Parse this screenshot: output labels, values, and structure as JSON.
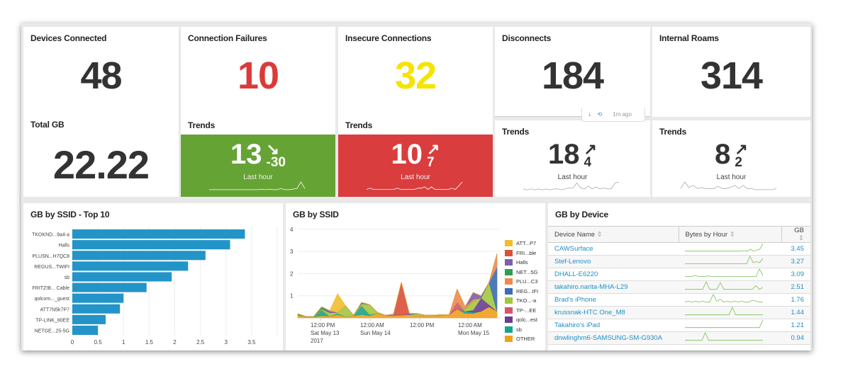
{
  "kpis": [
    {
      "title": "Devices Connected",
      "value": "48",
      "color": "#333333"
    },
    {
      "title": "Connection Failures",
      "value": "10",
      "color": "#dc3a3a"
    },
    {
      "title": "Insecure Connections",
      "value": "32",
      "color": "#f5e400"
    },
    {
      "title": "Disconnects",
      "value": "184",
      "color": "#333333"
    },
    {
      "title": "Internal Roams",
      "value": "314",
      "color": "#333333"
    }
  ],
  "total_gb": {
    "title": "Total GB",
    "value": "22.22"
  },
  "toolbar": {
    "download_icon": "download-icon",
    "refresh_icon": "refresh-icon",
    "updated": "1m ago"
  },
  "trends": [
    {
      "title": "Trends",
      "value": "13",
      "delta": "-30",
      "direction": "down",
      "label": "Last hour",
      "bg": "#66a335",
      "spark": [
        2,
        2,
        2,
        2,
        2,
        2,
        2,
        2,
        2,
        2,
        2,
        2,
        2,
        2.3,
        2,
        2.5,
        2,
        2,
        3,
        2,
        2,
        2.5,
        3,
        9,
        3
      ]
    },
    {
      "title": "Trends",
      "value": "10",
      "delta": "7",
      "direction": "up",
      "label": "Last hour",
      "bg": "#d93d3d",
      "spark": [
        2,
        3,
        2,
        2,
        2,
        2,
        2,
        2,
        2,
        3,
        2,
        2,
        2,
        2,
        2,
        3,
        3,
        4,
        2,
        4,
        2,
        2,
        2,
        2,
        2,
        3,
        2,
        5,
        8
      ]
    },
    {
      "title": "Trends",
      "value": "18",
      "delta": "4",
      "direction": "up",
      "label": "Last hour",
      "bg": "#ffffff",
      "spark": [
        3,
        2,
        3,
        2,
        3,
        2,
        3,
        2,
        3,
        3,
        2,
        3,
        4,
        4,
        9,
        4,
        3,
        6,
        3,
        5,
        3,
        4,
        3,
        3,
        9,
        10
      ]
    },
    {
      "title": "Trends",
      "value": "8",
      "delta": "2",
      "direction": "up",
      "label": "Last hour",
      "bg": "#ffffff",
      "spark": [
        3,
        9,
        4,
        6,
        3,
        4,
        3,
        3,
        3,
        5,
        3,
        3,
        4,
        6,
        3,
        6,
        3,
        3,
        2,
        2,
        2,
        2,
        2,
        3
      ]
    }
  ],
  "bar_chart": {
    "title": "GB by SSID - Top 10",
    "chart_data": {
      "type": "bar",
      "orientation": "horizontal",
      "categories": [
        "TKOKND...9a4-a",
        "Halls",
        "PLUSN...H7QC8",
        "REGUS...TWIFI",
        "sb",
        "FRITZ!B... Cable",
        "qolcom..._guest",
        "ATT7N5k7P7",
        "TP-LINK_80EE",
        "NETGE...25-5G"
      ],
      "values": [
        3.37,
        3.08,
        2.6,
        2.26,
        1.94,
        1.45,
        1.0,
        0.93,
        0.65,
        0.5
      ],
      "xlim": [
        0,
        4
      ],
      "xticks": [
        "0",
        "0.5",
        "1",
        "1.5",
        "2",
        "2.5",
        "3",
        "3.5"
      ],
      "grid": true,
      "color": "#2394c7"
    }
  },
  "area_chart": {
    "title": "GB by SSID",
    "chart_data": {
      "type": "area",
      "stacked": true,
      "ylim": [
        0,
        4
      ],
      "yticks": [
        "1",
        "2",
        "3",
        "4"
      ],
      "xticks": [
        {
          "l1": "12:00 PM",
          "l2": "Sat May 13",
          "l3": "2017"
        },
        {
          "l1": "12:00 AM",
          "l2": "Sun May 14",
          "l3": ""
        },
        {
          "l1": "12:00 PM",
          "l2": "",
          "l3": ""
        },
        {
          "l1": "12:00 AM",
          "l2": "Mon May 15",
          "l3": ""
        }
      ],
      "legend": "right",
      "series": [
        {
          "name": "OTHER",
          "color": "#f0a01c",
          "values": [
            0.12,
            0.05,
            0.05,
            0.1,
            0.08,
            0.15,
            0.05,
            0.1,
            0.15,
            0.1,
            0.2,
            0.1,
            0.1,
            0.12,
            0.15,
            0.1,
            0.1,
            0.1,
            0.1,
            0.15,
            0.4,
            0.2,
            0.2,
            0.3,
            0.5,
            0.3
          ]
        },
        {
          "name": "sb",
          "color": "#17a589",
          "values": [
            0.05,
            0,
            0,
            0.25,
            0,
            0.05,
            0,
            0,
            0.4,
            0.05,
            0,
            0,
            0,
            0,
            0,
            0,
            0,
            0,
            0,
            0,
            0,
            0.1,
            0.05,
            0,
            0,
            0
          ]
        },
        {
          "name": "qolc...est",
          "color": "#6c3d8f",
          "values": [
            0,
            0,
            0,
            0,
            0,
            0,
            0,
            0,
            0,
            0,
            0,
            0,
            0,
            0,
            0,
            0,
            0,
            0,
            0,
            0,
            0,
            0,
            0.1,
            0.6,
            0.1,
            0
          ]
        },
        {
          "name": "TP-...EE",
          "color": "#d9536b",
          "values": [
            0,
            0,
            0,
            0,
            0,
            0,
            0,
            0,
            0,
            0,
            0,
            0,
            0,
            0,
            0,
            0,
            0,
            0,
            0,
            0,
            0.3,
            0,
            0,
            0,
            0,
            0
          ]
        },
        {
          "name": "TKO...-a",
          "color": "#a2c83e",
          "values": [
            0.02,
            0.02,
            0.02,
            0.05,
            0.15,
            0.05,
            0.5,
            0.02,
            0.1,
            0.45,
            0.05,
            0.02,
            0.02,
            0,
            0,
            0.1,
            0.02,
            0.02,
            0.05,
            0,
            0,
            0.1,
            0.4,
            0,
            1.0,
            0
          ]
        },
        {
          "name": "REG...IFI",
          "color": "#3a6db3",
          "values": [
            0,
            0,
            0,
            0,
            0,
            0,
            0,
            0,
            0,
            0,
            0,
            0,
            0,
            0,
            0,
            0,
            0,
            0,
            0,
            0,
            0,
            0,
            0,
            0,
            0,
            2.0
          ]
        },
        {
          "name": "PLU...C3",
          "color": "#ef8a4f",
          "values": [
            0,
            0,
            0,
            0,
            0,
            0,
            0,
            0,
            0,
            0,
            0,
            0,
            0,
            0,
            0,
            0,
            0,
            0,
            0,
            0,
            0.6,
            0.1,
            0.1,
            0,
            0,
            0.6
          ]
        },
        {
          "name": "NET...5G",
          "color": "#2e9e56",
          "values": [
            0,
            0,
            0,
            0.1,
            0,
            0,
            0,
            0,
            0,
            0,
            0,
            0,
            0,
            0,
            0,
            0,
            0,
            0,
            0,
            0,
            0,
            0,
            0,
            0,
            0,
            0
          ]
        },
        {
          "name": "Halls",
          "color": "#7b60ad",
          "values": [
            0,
            0,
            0,
            0,
            0.1,
            0,
            0,
            0,
            0.05,
            0,
            0,
            0,
            0.05,
            0,
            0.05,
            0,
            0,
            0,
            0,
            0,
            0,
            0,
            0.3,
            0.1,
            0,
            0
          ]
        },
        {
          "name": "FRI...ble",
          "color": "#d9513a",
          "values": [
            0,
            0,
            0,
            0,
            0,
            0,
            0,
            0,
            0,
            0,
            0,
            0,
            0,
            1.5,
            0,
            0,
            0,
            0,
            0,
            0,
            0,
            0,
            0,
            0,
            0,
            0
          ]
        },
        {
          "name": "ATT...P7",
          "color": "#f2bc2f",
          "values": [
            0,
            0,
            0,
            0,
            0,
            0.85,
            0,
            0,
            0,
            0,
            0,
            0,
            0,
            0,
            0,
            0,
            0,
            0,
            0,
            0,
            0,
            0,
            0,
            0,
            0,
            0
          ]
        }
      ]
    }
  },
  "device_table": {
    "title": "GB by Device",
    "columns": [
      "Device Name",
      "Bytes by Hour",
      "GB"
    ],
    "rows": [
      {
        "name": "CAWSurface",
        "gb": "3.45",
        "spark": [
          1,
          1,
          1,
          1,
          1,
          1,
          1,
          1,
          1,
          1,
          1,
          1,
          1,
          1,
          1,
          1,
          1,
          1,
          1,
          1.5,
          1,
          3,
          1,
          2,
          3,
          9
        ]
      },
      {
        "name": "Stef-Lenovo",
        "gb": "3.27",
        "spark": [
          1,
          1,
          1,
          1,
          1,
          1,
          1,
          1,
          1,
          1,
          1,
          1,
          1,
          1,
          1,
          1,
          1,
          1,
          1,
          1,
          8,
          2,
          3,
          2,
          6
        ]
      },
      {
        "name": "DHALL-E6220",
        "gb": "3.09",
        "spark": [
          1,
          1,
          1,
          2,
          1,
          1,
          1,
          1.5,
          1,
          1,
          1,
          1,
          1,
          1,
          1,
          1,
          1,
          1,
          1,
          1,
          1,
          1,
          8,
          2
        ]
      },
      {
        "name": "takahiro.narita-MHA-L29",
        "gb": "2.51",
        "spark": [
          1,
          1,
          1,
          1,
          1,
          1,
          9,
          1,
          1,
          1,
          8,
          1,
          1,
          1,
          1,
          1,
          1,
          1,
          1,
          1,
          5,
          1,
          3
        ]
      },
      {
        "name": "Brad's iPhone",
        "gb": "1.76",
        "spark": [
          1,
          2,
          1,
          2,
          1,
          2,
          1,
          1,
          9,
          2,
          4,
          1,
          2,
          1,
          2,
          1,
          2,
          1,
          1,
          3,
          2,
          1,
          1
        ]
      },
      {
        "name": "krussnak-HTC One_M8",
        "gb": "1.44",
        "spark": [
          1,
          1,
          1,
          1,
          1,
          1,
          1,
          1,
          1,
          1,
          1,
          1,
          1,
          1,
          9,
          1,
          1,
          1,
          1,
          1,
          1,
          1,
          1,
          1
        ]
      },
      {
        "name": "Takahiro's iPad",
        "gb": "1.21",
        "spark": [
          1,
          1,
          1,
          1,
          1,
          1,
          1,
          1,
          1,
          1,
          1,
          1,
          1,
          1,
          1,
          1,
          1,
          1,
          1,
          1,
          1,
          1,
          1,
          9
        ]
      },
      {
        "name": "dnwlinghm6-SAMSUNG-SM-G930A",
        "gb": "0.94",
        "spark": [
          1,
          1,
          1,
          1,
          1,
          1,
          9,
          1,
          1,
          1,
          1,
          1,
          1,
          1,
          1,
          1,
          1,
          1,
          1,
          1,
          1,
          1,
          1,
          1
        ]
      }
    ]
  }
}
